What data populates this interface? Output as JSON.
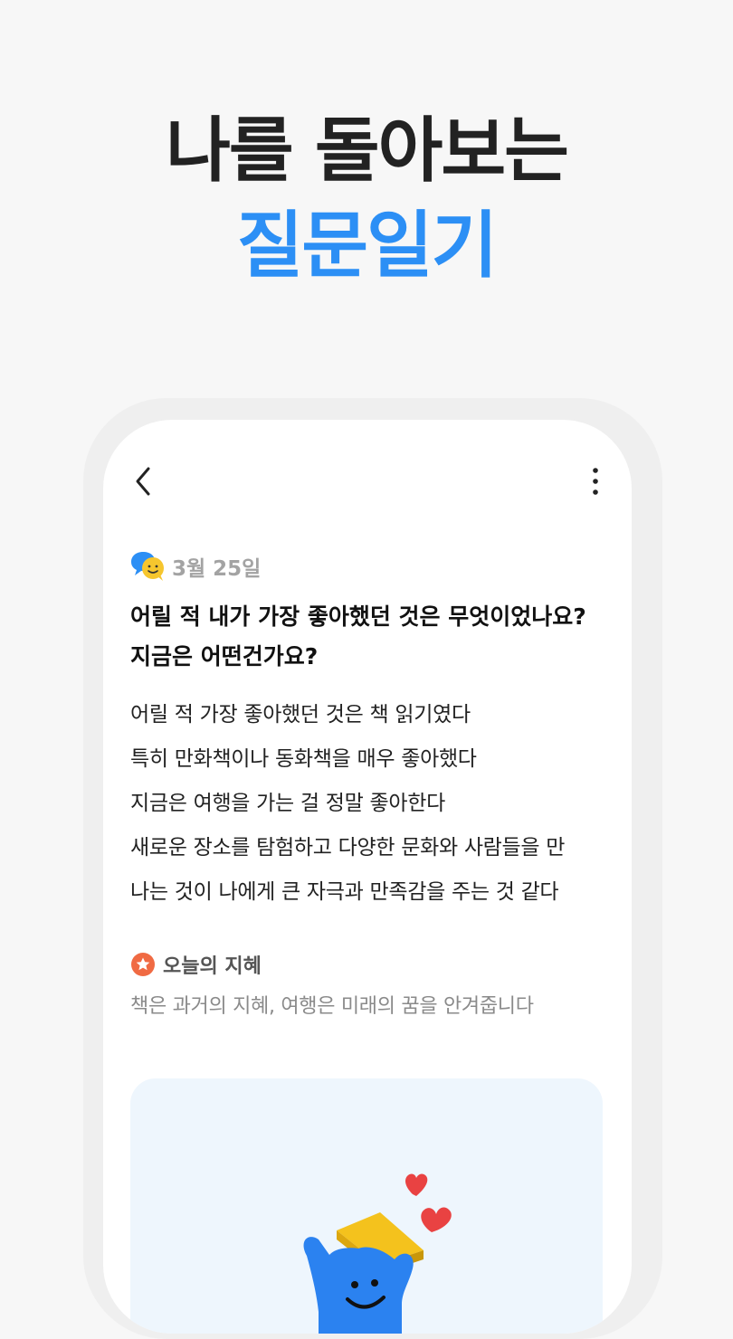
{
  "headline": {
    "line1": "나를 돌아보는",
    "line2": "질문일기"
  },
  "colors": {
    "accent": "#2c8ff5",
    "headline": "#222222",
    "background": "#f7f7f7",
    "star_badge": "#f06a43"
  },
  "phone": {
    "toolbar": {
      "back_icon": "chevron-left-icon",
      "more_icon": "more-vertical-icon"
    },
    "entry": {
      "date_icon": "chat-bubbles-smile-icon",
      "date": "3월 25일",
      "question": "어릴 적 내가 가장 좋아했던 것은 무엇이었나요? 지금은 어떤건가요?",
      "answer_lines": [
        "어릴 적 가장 좋아했던 것은 책 읽기였다",
        "특히 만화책이나 동화책을 매우 좋아했다",
        "지금은 여행을 가는 걸 정말 좋아한다",
        "새로운 장소를 탐험하고 다양한 문화와 사람들을 만",
        "나는 것이 나에게 큰 자극과 만족감을 주는 것 같다"
      ]
    },
    "wisdom": {
      "icon": "star-badge-icon",
      "title": "오늘의 지혜",
      "text": "책은 과거의 지혜, 여행은 미래의 꿈을 안겨줍니다"
    },
    "illustration": {
      "icons": [
        "blue-character-icon",
        "gold-box-lid-icon",
        "heart-icon"
      ]
    }
  }
}
